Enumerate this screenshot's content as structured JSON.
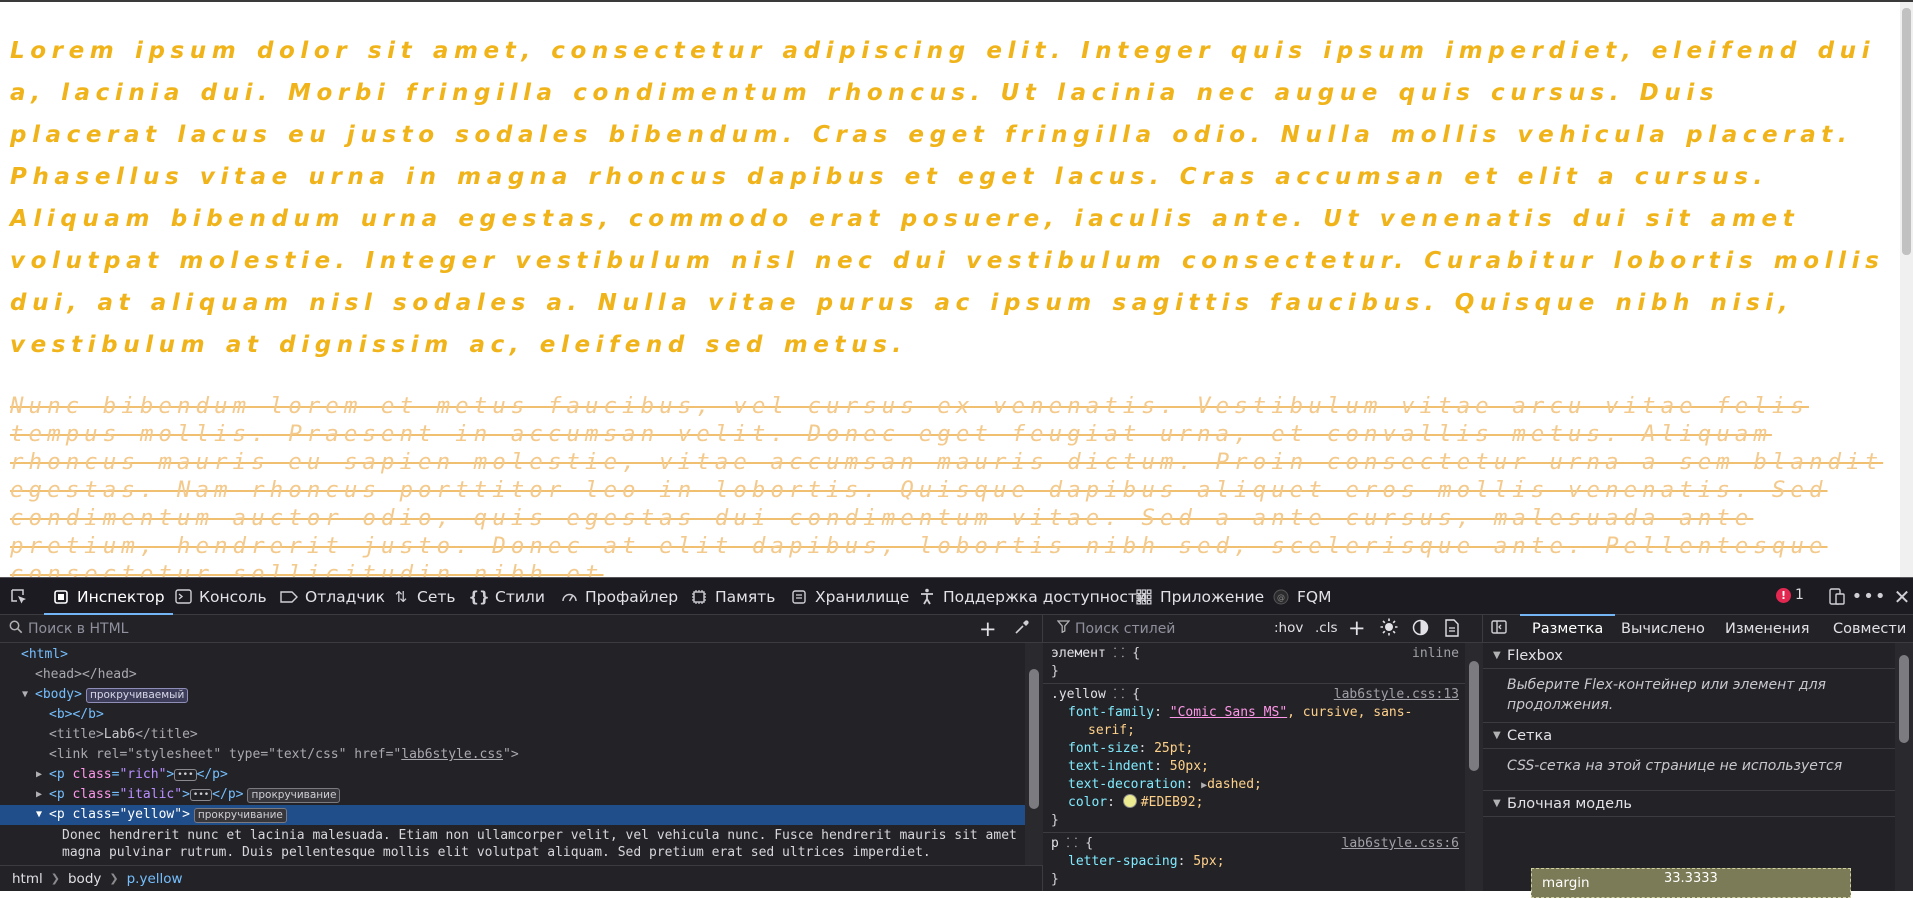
{
  "page": {
    "paragraph_rich": "Lorem ipsum dolor sit amet, consectetur adipiscing elit. Integer quis ipsum imperdiet, eleifend dui a, lacinia dui. Morbi fringilla condimentum rhoncus. Ut lacinia nec augue quis cursus. Duis placerat lacus eu justo sodales bibendum. Cras eget fringilla odio. Nulla mollis vehicula placerat. Phasellus vitae urna in magna rhoncus dapibus et eget lacus. Cras accumsan et elit a cursus. Aliquam bibendum urna egestas, commodo erat posuere, iaculis ante. Ut venenatis dui sit amet volutpat molestie. Integer vestibulum nisl nec dui vestibulum consectetur. Curabitur lobortis mollis dui, at aliquam nisl sodales a. Nulla vitae purus ac ipsum sagittis faucibus. Quisque nibh nisi, vestibulum at dignissim ac, eleifend sed metus.",
    "paragraph_italic": "Nunc bibendum lorem et metus faucibus, vel cursus ex venenatis. Vestibulum vitae arcu vitae felis tempus mollis. Praesent in accumsan velit. Donec eget feugiat urna, et convallis metus. Aliquam rhoncus mauris eu sapien molestie, vitae accumsan mauris dictum. Proin consectetur urna a sem blandit egestas. Nam rhoncus porttitor leo in lobortis. Quisque dapibus aliquet eros mollis venenatis. Sed condimentum auctor odio, quis egestas dui condimentum vitae. Sed a ante cursus, malesuada ante pretium, hendrerit justo. Donec at elit dapibus, lobortis nibh sed, scelerisque ante. Pellentesque consectetur sollicitudin nibh et",
    "colors": {
      "rich_text": "#f0b41a",
      "italic_text": "#f3c98c"
    }
  },
  "devtools": {
    "toolbar": {
      "pick_icon": "element-picker-icon",
      "tabs": [
        {
          "label": "Инспектор",
          "icon": "inspector-icon"
        },
        {
          "label": "Консоль",
          "icon": "console-icon"
        },
        {
          "label": "Отладчик",
          "icon": "debugger-icon"
        },
        {
          "label": "Сеть",
          "icon": "network-icon"
        },
        {
          "label": "Стили",
          "icon": "style-editor-icon"
        },
        {
          "label": "Профайлер",
          "icon": "profiler-icon"
        },
        {
          "label": "Память",
          "icon": "memory-icon"
        },
        {
          "label": "Хранилище",
          "icon": "storage-icon"
        },
        {
          "label": "Поддержка доступности",
          "icon": "accessibility-icon"
        },
        {
          "label": "Приложение",
          "icon": "application-icon"
        },
        {
          "label": "FQM",
          "icon": "fqm-icon"
        }
      ],
      "error_count": "1"
    },
    "html_pane": {
      "search_placeholder": "Поиск в HTML",
      "tree": {
        "html_open": "<html>",
        "head": "<head></head>",
        "body_open": "<body>",
        "body_badge": "прокручиваемый",
        "b": "<b></b>",
        "title_tag_open": "<title>",
        "title_text": "Lab6",
        "title_tag_close": "</title>",
        "link_open": "<link",
        "link_rel_attr": "rel",
        "link_rel_val": "\"stylesheet\"",
        "link_type_attr": "type",
        "link_type_val": "\"text/css\"",
        "link_href_attr": "href",
        "link_href_val": "lab6style.css",
        "p_rich_class": "\"rich\"",
        "p_italic_class": "\"italic\"",
        "p_italic_badge": "прокручивание",
        "p_yellow_class": "\"yellow\"",
        "p_yellow_badge": "прокручивание",
        "yellow_text": "Donec hendrerit nunc et lacinia malesuada. Etiam non ullamcorper velit, vel vehicula nunc. Fusce hendrerit mauris sit amet magna pulvinar rutrum. Duis pellentesque mollis elit volutpat aliquam. Sed pretium erat sed ultrices imperdiet."
      },
      "breadcrumbs": [
        "html",
        "body",
        "p.yellow"
      ]
    },
    "rules_pane": {
      "filter_placeholder": "Поиск стилей",
      "hov": ":hov",
      "cls": ".cls",
      "element_rule": {
        "selector": "элемент",
        "source": "inline"
      },
      "yellow_rule": {
        "selector": ".yellow",
        "source": "lab6style.css:13",
        "font_family_name": "font-family",
        "font_family_link": "\"Comic Sans MS\"",
        "font_family_rest": ", cursive, sans-",
        "font_family_cont": "serif;",
        "font_size_name": "font-size",
        "font_size_val": "25pt;",
        "text_indent_name": "text-indent",
        "text_indent_val": "50px;",
        "text_decoration_name": "text-decoration",
        "text_decoration_val": "dashed;",
        "color_name": "color",
        "color_val": "#EDEB92;"
      },
      "p_rule": {
        "selector": "p",
        "source": "lab6style.css:6",
        "letter_spacing_name": "letter-spacing",
        "letter_spacing_val": "5px;"
      }
    },
    "layout_pane": {
      "tabs": [
        "Разметка",
        "Вычислено",
        "Изменения",
        "Совмести"
      ],
      "flexbox_title": "Flexbox",
      "flexbox_msg": "Выберите Flex-контейнер или элемент для продолжения.",
      "grid_title": "Сетка",
      "grid_msg": "CSS-сетка на этой странице не используется",
      "box_title": "Блочная модель",
      "margin_label": "margin",
      "margin_value": "33.3333"
    }
  }
}
